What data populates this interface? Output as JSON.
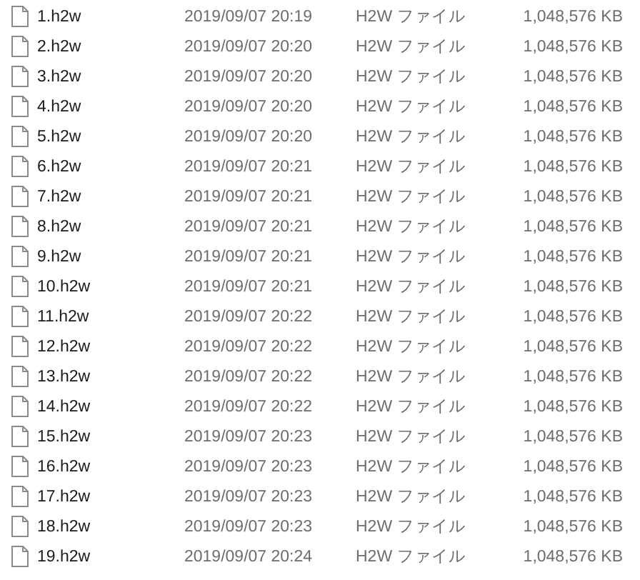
{
  "files": [
    {
      "name": "1.h2w",
      "modified": "2019/09/07 20:19",
      "type": "H2W ファイル",
      "size": "1,048,576 KB"
    },
    {
      "name": "2.h2w",
      "modified": "2019/09/07 20:20",
      "type": "H2W ファイル",
      "size": "1,048,576 KB"
    },
    {
      "name": "3.h2w",
      "modified": "2019/09/07 20:20",
      "type": "H2W ファイル",
      "size": "1,048,576 KB"
    },
    {
      "name": "4.h2w",
      "modified": "2019/09/07 20:20",
      "type": "H2W ファイル",
      "size": "1,048,576 KB"
    },
    {
      "name": "5.h2w",
      "modified": "2019/09/07 20:20",
      "type": "H2W ファイル",
      "size": "1,048,576 KB"
    },
    {
      "name": "6.h2w",
      "modified": "2019/09/07 20:21",
      "type": "H2W ファイル",
      "size": "1,048,576 KB"
    },
    {
      "name": "7.h2w",
      "modified": "2019/09/07 20:21",
      "type": "H2W ファイル",
      "size": "1,048,576 KB"
    },
    {
      "name": "8.h2w",
      "modified": "2019/09/07 20:21",
      "type": "H2W ファイル",
      "size": "1,048,576 KB"
    },
    {
      "name": "9.h2w",
      "modified": "2019/09/07 20:21",
      "type": "H2W ファイル",
      "size": "1,048,576 KB"
    },
    {
      "name": "10.h2w",
      "modified": "2019/09/07 20:21",
      "type": "H2W ファイル",
      "size": "1,048,576 KB"
    },
    {
      "name": "11.h2w",
      "modified": "2019/09/07 20:22",
      "type": "H2W ファイル",
      "size": "1,048,576 KB"
    },
    {
      "name": "12.h2w",
      "modified": "2019/09/07 20:22",
      "type": "H2W ファイル",
      "size": "1,048,576 KB"
    },
    {
      "name": "13.h2w",
      "modified": "2019/09/07 20:22",
      "type": "H2W ファイル",
      "size": "1,048,576 KB"
    },
    {
      "name": "14.h2w",
      "modified": "2019/09/07 20:22",
      "type": "H2W ファイル",
      "size": "1,048,576 KB"
    },
    {
      "name": "15.h2w",
      "modified": "2019/09/07 20:23",
      "type": "H2W ファイル",
      "size": "1,048,576 KB"
    },
    {
      "name": "16.h2w",
      "modified": "2019/09/07 20:23",
      "type": "H2W ファイル",
      "size": "1,048,576 KB"
    },
    {
      "name": "17.h2w",
      "modified": "2019/09/07 20:23",
      "type": "H2W ファイル",
      "size": "1,048,576 KB"
    },
    {
      "name": "18.h2w",
      "modified": "2019/09/07 20:23",
      "type": "H2W ファイル",
      "size": "1,048,576 KB"
    },
    {
      "name": "19.h2w",
      "modified": "2019/09/07 20:24",
      "type": "H2W ファイル",
      "size": "1,048,576 KB"
    }
  ]
}
